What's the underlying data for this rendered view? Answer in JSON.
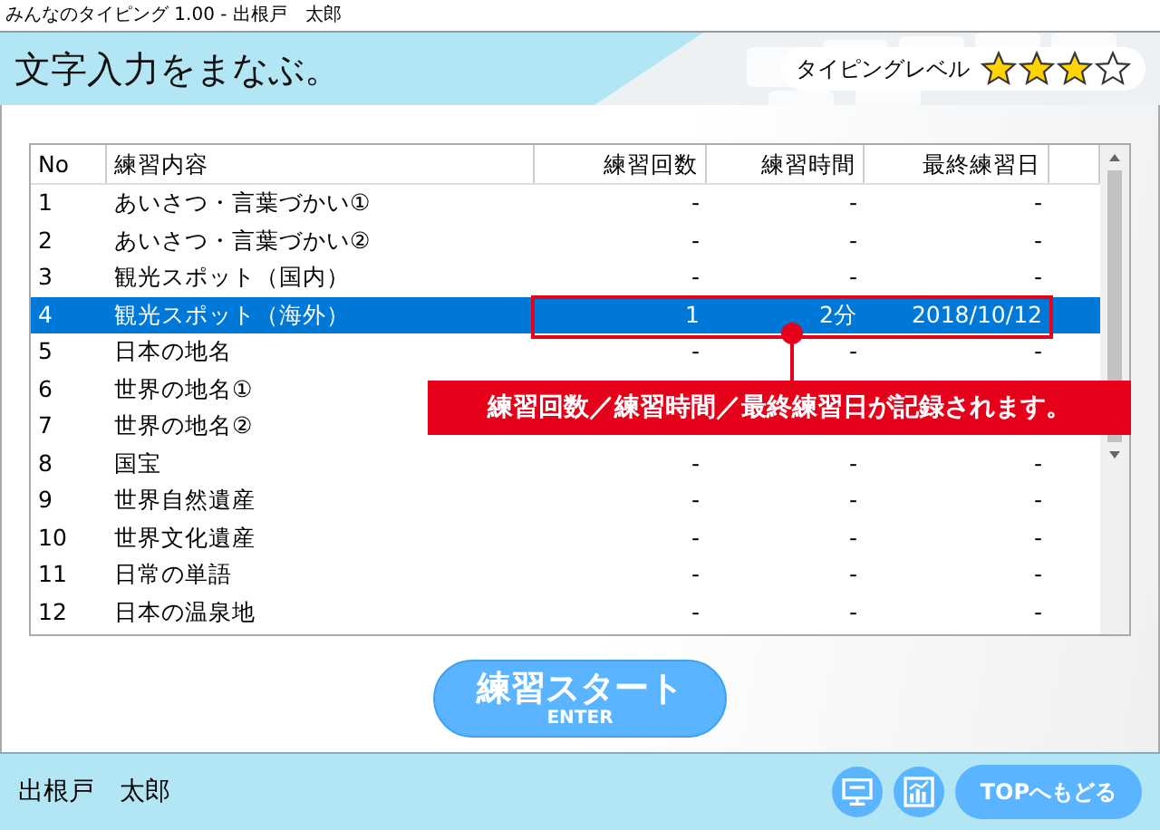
{
  "window": {
    "title": "みんなのタイピング 1.00 - 出根戸　太郎"
  },
  "header": {
    "title": "文字入力をまなぶ。",
    "level_label": "タイピングレベル",
    "stars": 3
  },
  "table": {
    "columns": [
      "No",
      "練習内容",
      "練習回数",
      "練習時間",
      "最終練習日"
    ],
    "rows": [
      {
        "no": "1",
        "content": "あいさつ・言葉づかい①",
        "count": "-",
        "time": "-",
        "last": "-",
        "selected": false
      },
      {
        "no": "2",
        "content": "あいさつ・言葉づかい②",
        "count": "-",
        "time": "-",
        "last": "-",
        "selected": false
      },
      {
        "no": "3",
        "content": "観光スポット（国内）",
        "count": "-",
        "time": "-",
        "last": "-",
        "selected": false
      },
      {
        "no": "4",
        "content": "観光スポット（海外）",
        "count": "1",
        "time": "2分",
        "last": "2018/10/12",
        "selected": true
      },
      {
        "no": "5",
        "content": "日本の地名",
        "count": "-",
        "time": "-",
        "last": "-",
        "selected": false
      },
      {
        "no": "6",
        "content": "世界の地名①",
        "selected": false
      },
      {
        "no": "7",
        "content": "世界の地名②",
        "selected": false
      },
      {
        "no": "8",
        "content": "国宝",
        "count": "-",
        "time": "-",
        "last": "-",
        "selected": false
      },
      {
        "no": "9",
        "content": "世界自然遺産",
        "count": "-",
        "time": "-",
        "last": "-",
        "selected": false
      },
      {
        "no": "10",
        "content": "世界文化遺産",
        "count": "-",
        "time": "-",
        "last": "-",
        "selected": false
      },
      {
        "no": "11",
        "content": "日常の単語",
        "count": "-",
        "time": "-",
        "last": "-",
        "selected": false
      },
      {
        "no": "12",
        "content": "日本の温泉地",
        "count": "-",
        "time": "-",
        "last": "-",
        "selected": false
      }
    ]
  },
  "callout": {
    "text": "練習回数／練習時間／最終練習日が記録されます。"
  },
  "start_button": {
    "label": "練習スタート",
    "sublabel": "ENTER"
  },
  "footer": {
    "user_name": "出根戸　太郎",
    "top_button": "TOPへもどる"
  }
}
